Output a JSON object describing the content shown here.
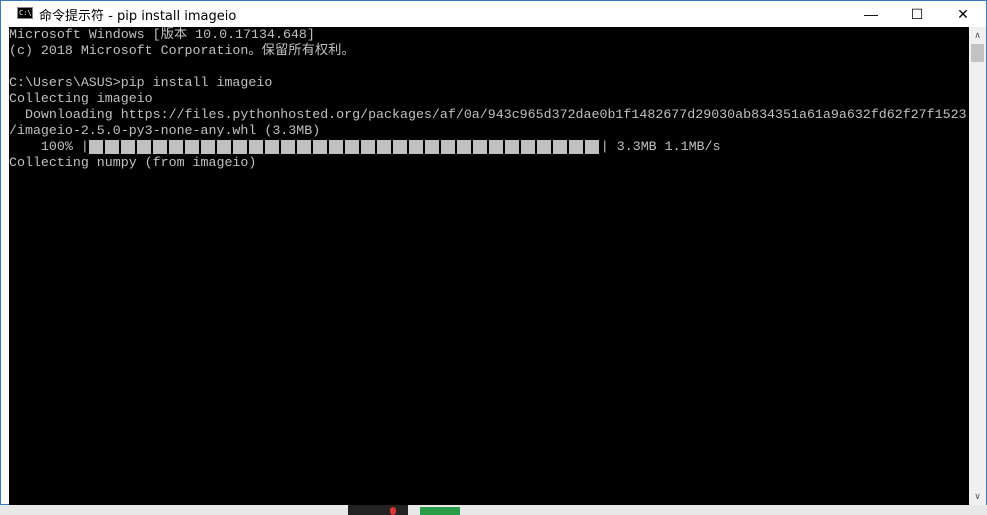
{
  "window": {
    "title": "命令提示符 - pip  install imageio",
    "icon": "cmd-icon",
    "icon_text": "C:\\",
    "controls": {
      "minimize": "—",
      "maximize": "☐",
      "close": "✕"
    }
  },
  "console": {
    "lines": [
      "Microsoft Windows [版本 10.0.17134.648]",
      "(c) 2018 Microsoft Corporation。保留所有权利。",
      "",
      "C:\\Users\\ASUS>pip install imageio",
      "Collecting imageio",
      "  Downloading https://files.pythonhosted.org/packages/af/0a/943c965d372dae0b1f1482677d29030ab834351a61a9a632fd62f27f1523",
      "/imageio-2.5.0-py3-none-any.whl (3.3MB)"
    ],
    "progress": {
      "prefix": "    100% |",
      "percent": 100,
      "suffix": "| 3.3MB 1.1MB/s"
    },
    "after": "Collecting numpy (from imageio)"
  },
  "scrollbar": {
    "up": "∧",
    "down": "∨"
  }
}
